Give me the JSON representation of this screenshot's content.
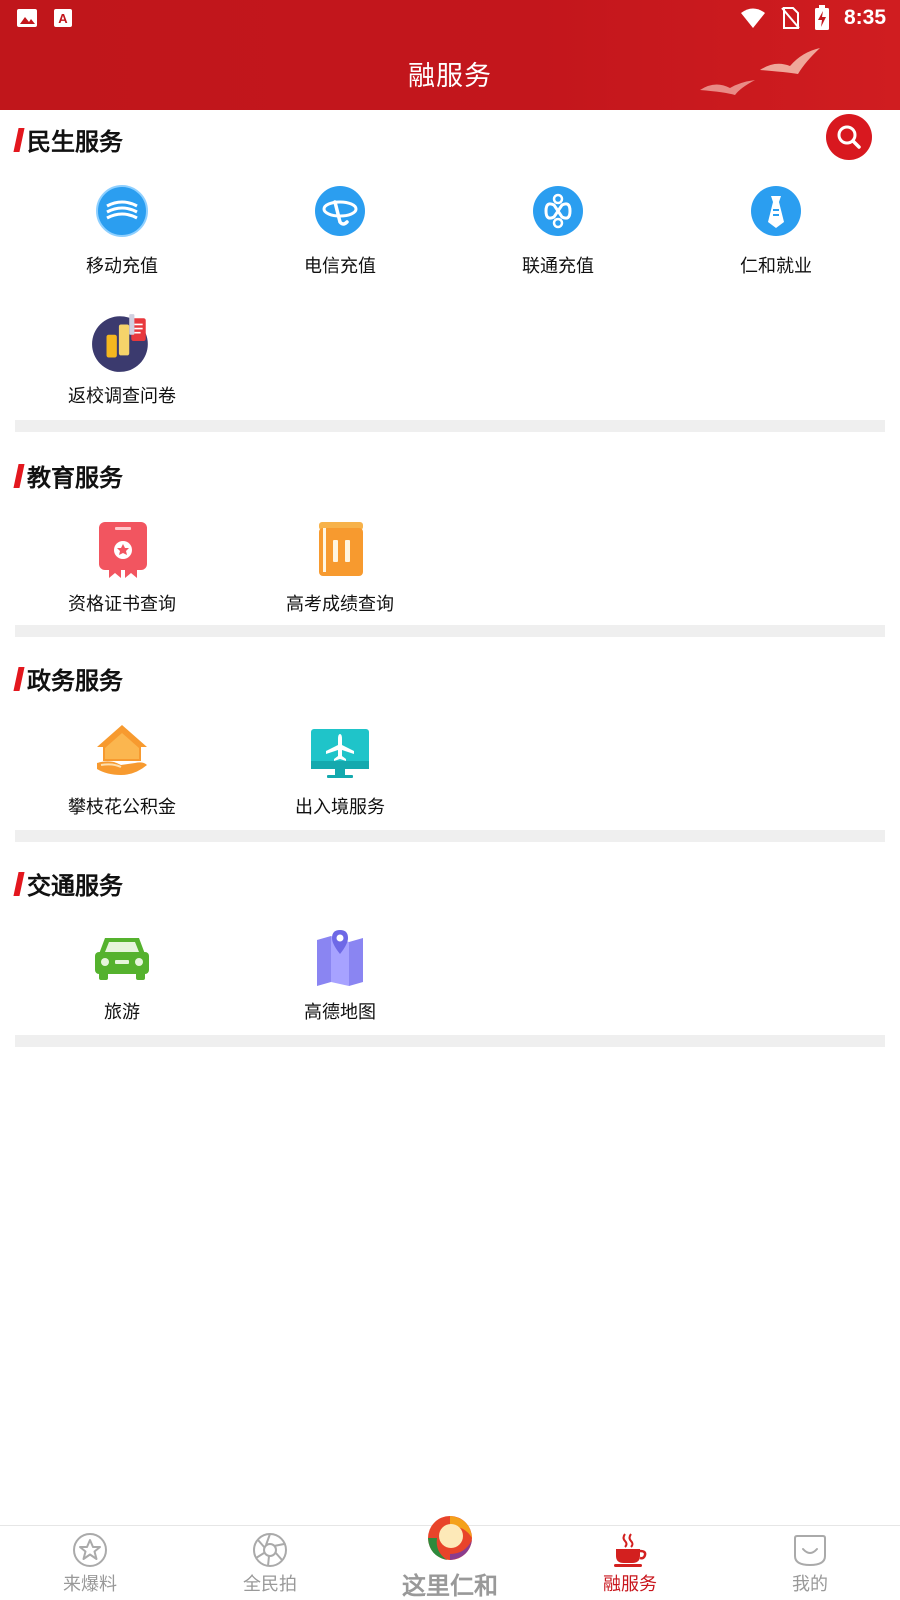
{
  "status_bar": {
    "time": "8:35"
  },
  "header": {
    "title": "融服务"
  },
  "colors": {
    "primary": "#c3161c",
    "accent": "#e3171e",
    "divider": "#efefef",
    "inactive": "#999999"
  },
  "sections": [
    {
      "title": "民生服务",
      "items": [
        {
          "label": "移动充值",
          "icon": "china-mobile-icon"
        },
        {
          "label": "电信充值",
          "icon": "china-telecom-icon"
        },
        {
          "label": "联通充值",
          "icon": "china-unicom-icon"
        },
        {
          "label": "仁和就业",
          "icon": "employment-tie-icon"
        },
        {
          "label": "返校调查问卷",
          "icon": "survey-icon"
        }
      ]
    },
    {
      "title": "教育服务",
      "items": [
        {
          "label": "资格证书查询",
          "icon": "certificate-icon"
        },
        {
          "label": "高考成绩查询",
          "icon": "book-icon"
        }
      ]
    },
    {
      "title": "政务服务",
      "items": [
        {
          "label": "攀枝花公积金",
          "icon": "house-fund-icon"
        },
        {
          "label": "出入境服务",
          "icon": "airplane-monitor-icon"
        }
      ]
    },
    {
      "title": "交通服务",
      "items": [
        {
          "label": "旅游",
          "icon": "car-icon"
        },
        {
          "label": "高德地图",
          "icon": "map-icon"
        }
      ]
    }
  ],
  "bottom_nav": [
    {
      "label": "来爆料",
      "icon": "star-icon"
    },
    {
      "label": "全民拍",
      "icon": "camera-aperture-icon"
    },
    {
      "label": "这里仁和",
      "icon": "app-logo-icon"
    },
    {
      "label": "融服务",
      "icon": "coffee-cup-icon",
      "active": true
    },
    {
      "label": "我的",
      "icon": "smile-face-icon"
    }
  ]
}
